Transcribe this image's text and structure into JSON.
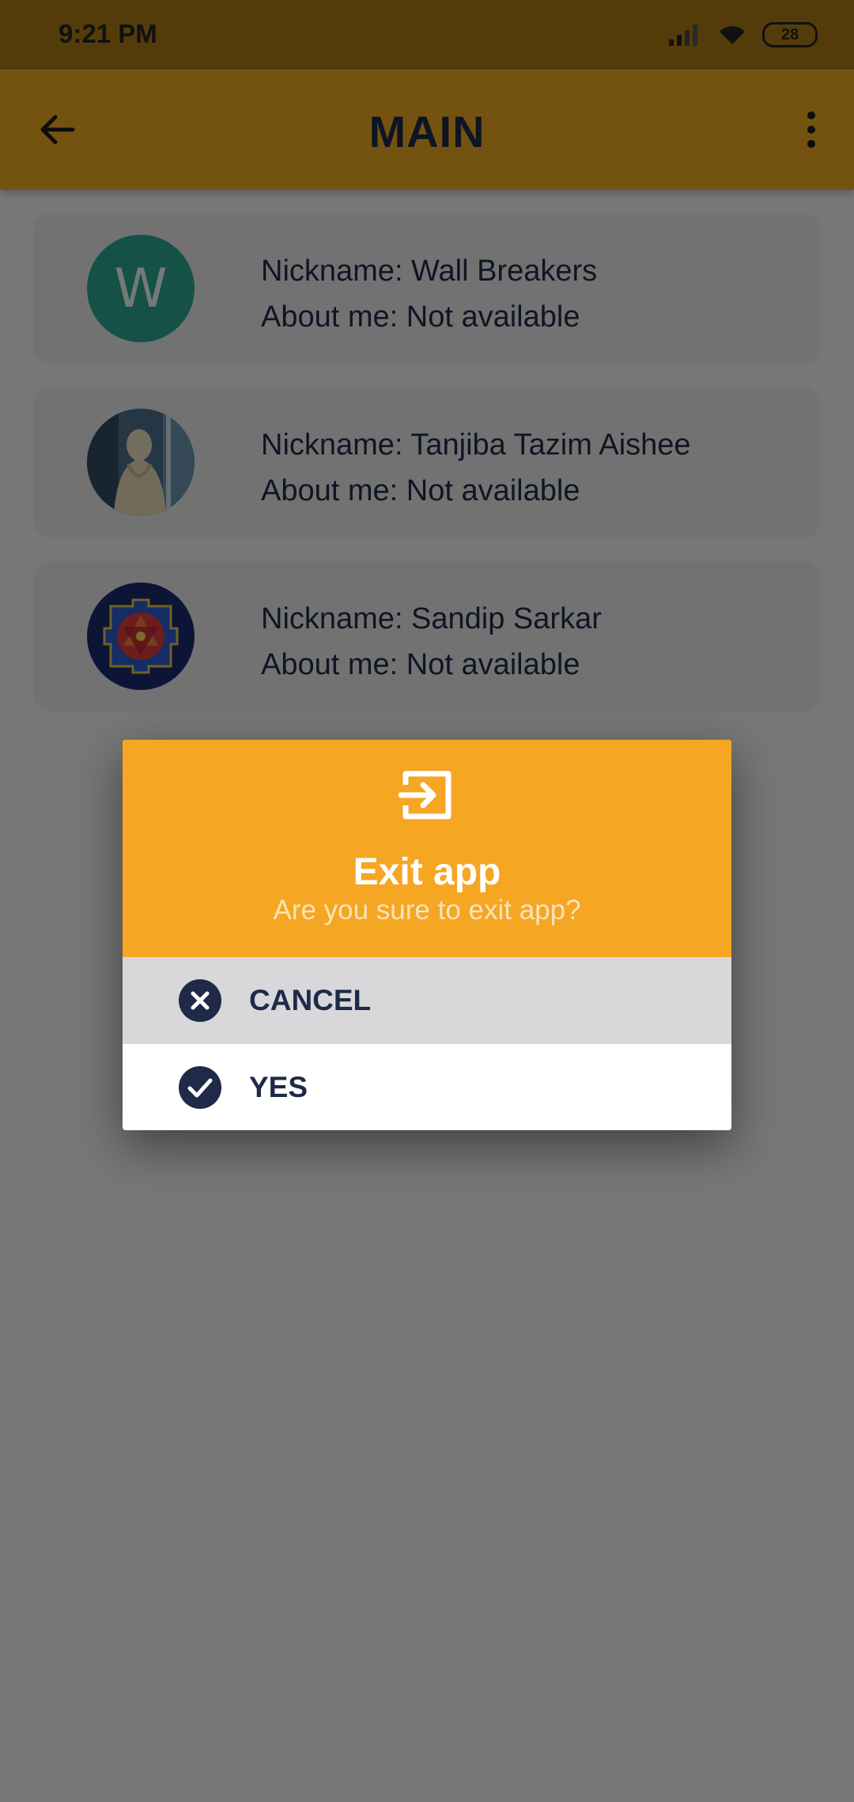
{
  "status_bar": {
    "time": "9:21 PM",
    "battery": "28",
    "icons": [
      "signal-icon",
      "wifi-icon",
      "battery-icon"
    ]
  },
  "app_bar": {
    "title": "MAIN",
    "icons": [
      "arrow-back-icon",
      "more-vert-icon"
    ]
  },
  "contacts": [
    {
      "avatar_type": "letter",
      "avatar_letter": "W",
      "avatar_color": "#2aa38f",
      "nickname": "Nickname: Wall Breakers",
      "about": "About me: Not available"
    },
    {
      "avatar_type": "photo",
      "avatar_description": "portrait-photo",
      "nickname": "Nickname: Tanjiba Tazim Aishee",
      "about": "About me: Not available"
    },
    {
      "avatar_type": "photo",
      "avatar_description": "yantra-symbol",
      "nickname": "Nickname: Sandip Sarkar",
      "about": "About me: Not available"
    }
  ],
  "dialog": {
    "icon": "exit-to-app-icon",
    "title": "Exit app",
    "subtitle": "Are you sure to exit app?",
    "options": [
      {
        "label": "CANCEL",
        "icon": "cancel-circle-icon"
      },
      {
        "label": "YES",
        "icon": "check-circle-icon"
      }
    ]
  },
  "colors": {
    "accent": "#f5a623",
    "app_bar": "#e8a722",
    "text_dark": "#1e2a47"
  }
}
